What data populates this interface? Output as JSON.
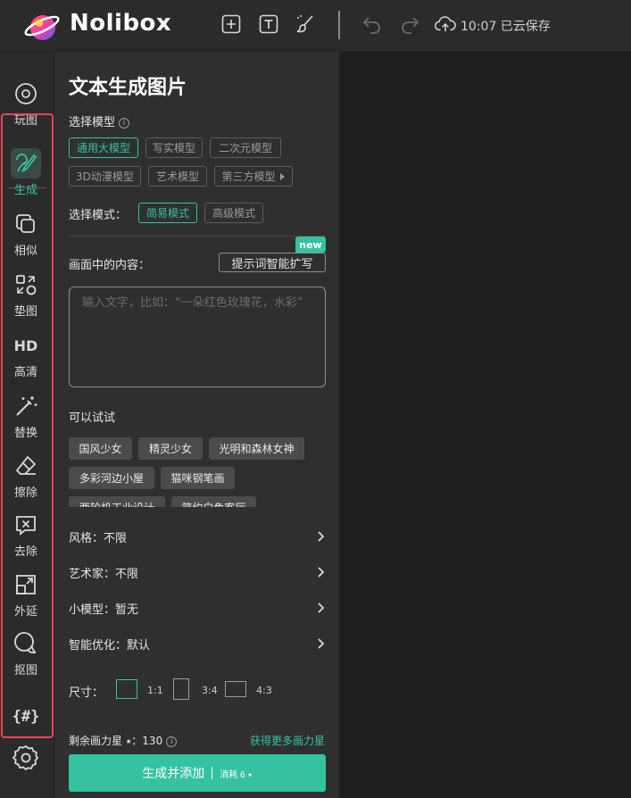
{
  "brand": "Nolibox",
  "colors": {
    "accent": "#35c2a1",
    "highlight": "#e5455e"
  },
  "topbar": {
    "icons": [
      "add-square-icon",
      "text-icon",
      "brush-icon",
      "undo-icon",
      "redo-icon",
      "cloud-upload-icon"
    ],
    "save_status": "10:07 已云保存"
  },
  "sidebar": {
    "items": [
      {
        "label": "玩图",
        "icon": "disc-icon"
      },
      {
        "label": "生成",
        "icon": "generate-icon",
        "active": true
      },
      {
        "label": "相似",
        "icon": "copy-icon"
      },
      {
        "label": "垫图",
        "icon": "pad-icon"
      },
      {
        "label": "高清",
        "icon": "hd-icon"
      },
      {
        "label": "替换",
        "icon": "magic-wand-icon"
      },
      {
        "label": "擦除",
        "icon": "eraser-icon"
      },
      {
        "label": "去除",
        "icon": "remove-icon"
      },
      {
        "label": "外延",
        "icon": "expand-icon"
      },
      {
        "label": "抠图",
        "icon": "cutout-icon"
      }
    ],
    "bottom": [
      {
        "label": "{#}",
        "icon": "variables-icon"
      },
      {
        "icon": "settings-icon"
      }
    ]
  },
  "panel": {
    "title": "文本生成图片",
    "model_label": "选择模型",
    "info_mark": "i",
    "models": [
      {
        "label": "通用大模型",
        "selected": true
      },
      {
        "label": "写实模型"
      },
      {
        "label": "二次元模型"
      },
      {
        "label": "3D动漫模型"
      },
      {
        "label": "艺术模型"
      },
      {
        "label": "第三方模型"
      }
    ],
    "mode_label": "选择模式：",
    "modes": [
      {
        "label": "简易模式",
        "selected": true
      },
      {
        "label": "高级模式"
      }
    ],
    "new_badge": "new",
    "content_label": "画面中的内容：",
    "expand_button": "提示词智能扩写",
    "prompt_placeholder": "输入文字，比如：“一朵红色玫瑰花，水彩”",
    "prompt_value": "",
    "try_label": "可以试试",
    "suggestions": [
      "国风少女",
      "精灵少女",
      "光明和森林女神",
      "多彩河边小屋",
      "猫咪钢笔画",
      "两轮机工业设计",
      "简约白色客厅"
    ],
    "settings": [
      {
        "label": "风格：不限"
      },
      {
        "label": "艺术家：不限"
      },
      {
        "label": "小模型：暂无"
      },
      {
        "label": "智能优化：默认"
      }
    ],
    "size_label": "尺寸：",
    "sizes": [
      {
        "label": "1:1",
        "selected": true
      },
      {
        "label": "3:4"
      },
      {
        "label": "4:3"
      }
    ],
    "stars_text": "剩余画力星 ⭑：130",
    "more_stars": "获得更多画力星",
    "generate_button": "生成并添加",
    "generate_cost": "消耗 6 ⭑"
  }
}
